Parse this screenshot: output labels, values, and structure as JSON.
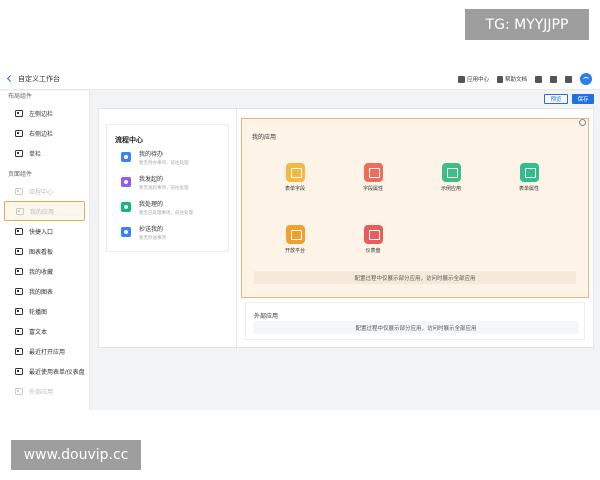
{
  "watermarks": {
    "top": "TG: MYYJJPP",
    "bottom": "www.douvip.cc"
  },
  "header": {
    "back_label": "自定义工作台",
    "links": {
      "app_center": "应用中心",
      "help_docs": "帮助文档"
    }
  },
  "sidebar": {
    "layout_title": "布局组件",
    "layout_items": [
      "左侧边栏",
      "右侧边栏",
      "单栏"
    ],
    "page_title": "页面组件",
    "page_items": [
      {
        "label": "流程中心",
        "state": "disabled"
      },
      {
        "label": "我的应用",
        "state": "active"
      },
      {
        "label": "快捷入口",
        "state": "normal"
      },
      {
        "label": "图表看板",
        "state": "normal"
      },
      {
        "label": "我的收藏",
        "state": "normal"
      },
      {
        "label": "我的图表",
        "state": "normal"
      },
      {
        "label": "轮播图",
        "state": "normal"
      },
      {
        "label": "富文本",
        "state": "normal"
      },
      {
        "label": "最近打开应用",
        "state": "normal"
      },
      {
        "label": "最近使用表单/仪表盘",
        "state": "normal"
      },
      {
        "label": "外部应用",
        "state": "disabled"
      }
    ]
  },
  "toolbar": {
    "preview_label": "预览",
    "save_label": "保存"
  },
  "process_center": {
    "title": "流程中心",
    "items": [
      {
        "title": "我的待办",
        "sub": "暂无待办事项，前往处理",
        "color": "#3b82f6"
      },
      {
        "title": "我发起的",
        "sub": "暂无发起事项，前往处理",
        "color": "#8b5cf6"
      },
      {
        "title": "我处理的",
        "sub": "暂无已处理事项，前往处理",
        "color": "#10b981"
      },
      {
        "title": "抄送我的",
        "sub": "暂无抄送事项",
        "color": "#3b82f6"
      }
    ]
  },
  "my_apps": {
    "title": "我的应用",
    "tiles": [
      {
        "label": "表单字段",
        "color": "#f4b942"
      },
      {
        "label": "字段属性",
        "color": "#ee6d5a"
      },
      {
        "label": "示例应用",
        "color": "#3cbf86"
      },
      {
        "label": "表单属性",
        "color": "#2fbf8f"
      },
      {
        "label": "开放平台",
        "color": "#f0a030"
      },
      {
        "label": "仪表盘",
        "color": "#e85d5d"
      }
    ],
    "note": "配置过程中仅展示部分应用，访问时展示全部应用"
  },
  "external_apps": {
    "title": "外部应用",
    "note": "配置过程中仅展示部分应用，访问时展示全部应用"
  }
}
